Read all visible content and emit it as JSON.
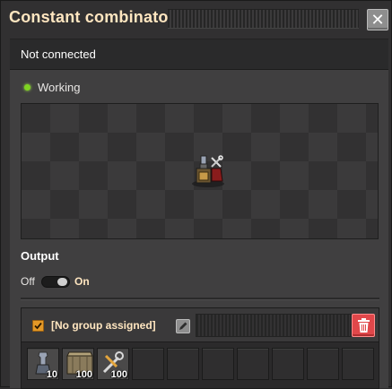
{
  "window": {
    "title": "Constant combinator",
    "close_icon": "close-icon"
  },
  "status": {
    "connection": "Not connected",
    "state": "Working",
    "state_color": "#7ed321"
  },
  "output": {
    "label": "Output",
    "switch_off_label": "Off",
    "switch_on_label": "On",
    "switch_state": "on"
  },
  "section": {
    "enabled": true,
    "group_label": "[No group assigned]",
    "edit_icon": "pencil-icon",
    "delete_icon": "trash-icon",
    "delete_color": "#e0474a",
    "slots": [
      {
        "icon": "lamp-icon",
        "count": "10"
      },
      {
        "icon": "stone-wall-icon",
        "count": "100"
      },
      {
        "icon": "repair-pack-icon",
        "count": "100"
      },
      {
        "icon": "",
        "count": ""
      },
      {
        "icon": "",
        "count": ""
      },
      {
        "icon": "",
        "count": ""
      },
      {
        "icon": "",
        "count": ""
      },
      {
        "icon": "",
        "count": ""
      },
      {
        "icon": "",
        "count": ""
      },
      {
        "icon": "",
        "count": ""
      }
    ]
  }
}
